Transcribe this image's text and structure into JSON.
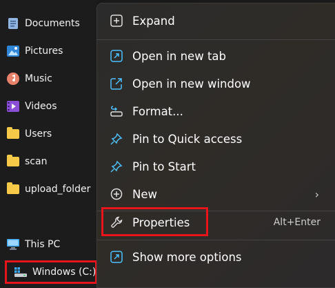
{
  "sidebar": {
    "items": [
      {
        "label": "Documents",
        "icon": "documents-icon"
      },
      {
        "label": "Pictures",
        "icon": "pictures-icon"
      },
      {
        "label": "Music",
        "icon": "music-icon"
      },
      {
        "label": "Videos",
        "icon": "videos-icon"
      },
      {
        "label": "Users",
        "icon": "folder-icon"
      },
      {
        "label": "scan",
        "icon": "folder-icon"
      },
      {
        "label": "upload_folder",
        "icon": "folder-icon"
      },
      {
        "label": "This PC",
        "icon": "this-pc-icon"
      },
      {
        "label": "Windows (C:)",
        "icon": "drive-icon"
      }
    ]
  },
  "context_menu": {
    "expand": "Expand",
    "open_new_tab": "Open in new tab",
    "open_new_window": "Open in new window",
    "format": "Format...",
    "pin_quick_access": "Pin to Quick access",
    "pin_start": "Pin to Start",
    "new": "New",
    "properties": "Properties",
    "properties_shortcut": "Alt+Enter",
    "show_more": "Show more options"
  },
  "colors": {
    "highlight_box": "#e8141c",
    "accent_icon": "#4cc2ff",
    "folder": "#f7c948"
  }
}
